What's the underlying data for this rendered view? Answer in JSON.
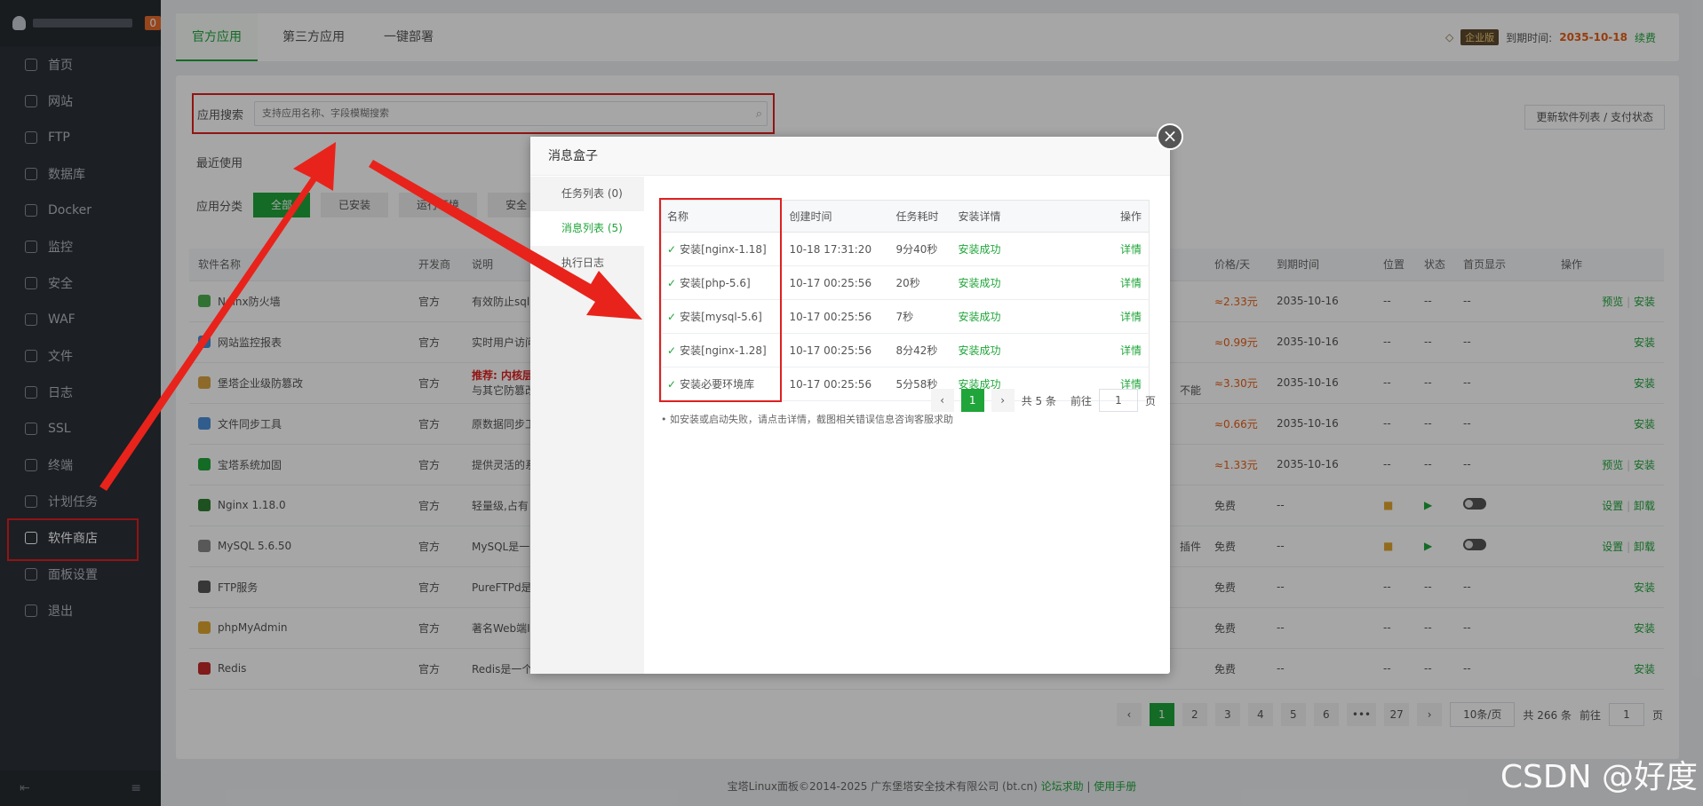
{
  "sidebar": {
    "brand_badge": "0",
    "items": [
      {
        "label": "首页",
        "icon": "home-icon"
      },
      {
        "label": "网站",
        "icon": "globe-icon"
      },
      {
        "label": "FTP",
        "icon": "ftp-icon"
      },
      {
        "label": "数据库",
        "icon": "database-icon"
      },
      {
        "label": "Docker",
        "icon": "docker-icon"
      },
      {
        "label": "监控",
        "icon": "monitor-icon"
      },
      {
        "label": "安全",
        "icon": "shield-icon"
      },
      {
        "label": "WAF",
        "icon": "waf-icon"
      },
      {
        "label": "文件",
        "icon": "folder-icon"
      },
      {
        "label": "日志",
        "icon": "log-icon"
      },
      {
        "label": "SSL",
        "icon": "ssl-icon"
      },
      {
        "label": "终端",
        "icon": "terminal-icon"
      },
      {
        "label": "计划任务",
        "icon": "clock-icon"
      },
      {
        "label": "软件商店",
        "icon": "grid-icon"
      },
      {
        "label": "面板设置",
        "icon": "gear-icon"
      },
      {
        "label": "退出",
        "icon": "logout-icon"
      }
    ]
  },
  "topbar": {
    "tabs": [
      "官方应用",
      "第三方应用",
      "一键部署"
    ],
    "edition": "企业版",
    "expire_label": "到期时间:",
    "expire_date": "2035-10-18",
    "renew": "续费"
  },
  "search": {
    "label": "应用搜索",
    "placeholder": "支持应用名称、字段模糊搜索"
  },
  "update_button": "更新软件列表 / 支付状态",
  "recent_label": "最近使用",
  "category": {
    "label": "应用分类",
    "items": [
      "全部",
      "已安装",
      "运行环境",
      "安全"
    ]
  },
  "apps_table": {
    "headers": [
      "软件名称",
      "开发商",
      "说明",
      "价格/天",
      "到期时间",
      "位置",
      "状态",
      "首页显示",
      "操作"
    ],
    "rows": [
      {
        "name": "Nginx防火墙",
        "dev": "官方",
        "desc": "有效防止sql",
        "price": "≈2.33元",
        "expire": "2035-10-16",
        "pos": "--",
        "status": "--",
        "home": "--",
        "ops": [
          "预览",
          "安装"
        ],
        "color": "#4caf50"
      },
      {
        "name": "网站监控报表",
        "dev": "官方",
        "desc": "实时用户访问",
        "price": "≈0.99元",
        "expire": "2035-10-16",
        "pos": "--",
        "status": "--",
        "home": "--",
        "ops": [
          "安装"
        ],
        "color": "#3f8fd8"
      },
      {
        "name": "堡塔企业级防篡改",
        "dev": "官方",
        "desc": "推荐: 内核层",
        "desc2": "与其它防篡改",
        "price": "≈3.30元",
        "expire": "2035-10-16",
        "pos": "--",
        "status": "--",
        "home": "--",
        "ops": [
          "安装"
        ],
        "color": "#d9a441",
        "note": "不能"
      },
      {
        "name": "文件同步工具",
        "dev": "官方",
        "desc": "原数据同步工",
        "price": "≈0.66元",
        "expire": "2035-10-16",
        "pos": "--",
        "status": "--",
        "home": "--",
        "ops": [
          "安装"
        ],
        "color": "#4a90d9"
      },
      {
        "name": "宝塔系统加固",
        "dev": "官方",
        "desc": "提供灵活的系",
        "price": "≈1.33元",
        "expire": "2035-10-16",
        "pos": "--",
        "status": "--",
        "home": "--",
        "ops": [
          "预览",
          "安装"
        ],
        "color": "#20a53a"
      },
      {
        "name": "Nginx 1.18.0",
        "dev": "官方",
        "desc": "轻量级,占有",
        "price": "免费",
        "expire": "--",
        "pos": "folder",
        "status": "play",
        "home": "toggle",
        "ops": [
          "设置",
          "卸载"
        ],
        "color": "#2e7d32"
      },
      {
        "name": "MySQL 5.6.50",
        "dev": "官方",
        "desc": "MySQL是一",
        "price": "免费",
        "expire": "--",
        "pos": "folder",
        "status": "play",
        "home": "toggle",
        "ops": [
          "设置",
          "卸载"
        ],
        "color": "#888888",
        "note": "插件"
      },
      {
        "name": "FTP服务",
        "dev": "官方",
        "desc": "PureFTPd是",
        "price": "免费",
        "expire": "--",
        "pos": "--",
        "status": "--",
        "home": "--",
        "ops": [
          "安装"
        ],
        "color": "#555555"
      },
      {
        "name": "phpMyAdmin",
        "dev": "官方",
        "desc": "著名Web端I",
        "price": "免费",
        "expire": "--",
        "pos": "--",
        "status": "--",
        "home": "--",
        "ops": [
          "安装"
        ],
        "color": "#e0a72e"
      },
      {
        "name": "Redis",
        "dev": "官方",
        "desc": "Redis是一个",
        "price": "免费",
        "expire": "--",
        "pos": "--",
        "status": "--",
        "home": "--",
        "ops": [
          "安装"
        ],
        "color": "#c62828"
      }
    ]
  },
  "pager": {
    "pages": [
      "1",
      "2",
      "3",
      "4",
      "5",
      "6",
      "•••",
      "27"
    ],
    "per_page": "10条/页",
    "total": "共 266 条",
    "goto": "前往",
    "goto_value": "1",
    "page_unit": "页"
  },
  "footer": {
    "text": "宝塔Linux面板©2014-2025 广东堡塔安全技术有限公司 (bt.cn)",
    "forum": "论坛求助",
    "sep": "|",
    "manual": "使用手册"
  },
  "watermark": "CSDN @好度",
  "modal": {
    "title": "消息盒子",
    "close": "×",
    "tabs": [
      "任务列表 (0)",
      "消息列表 (5)",
      "执行日志"
    ],
    "headers": [
      "名称",
      "创建时间",
      "任务耗时",
      "安装详情",
      "操作"
    ],
    "rows": [
      {
        "name": "安装[nginx-1.18]",
        "time": "10-18 17:31:20",
        "cost": "9分40秒",
        "result": "安装成功",
        "op": "详情"
      },
      {
        "name": "安装[php-5.6]",
        "time": "10-17 00:25:56",
        "cost": "20秒",
        "result": "安装成功",
        "op": "详情"
      },
      {
        "name": "安装[mysql-5.6]",
        "time": "10-17 00:25:56",
        "cost": "7秒",
        "result": "安装成功",
        "op": "详情"
      },
      {
        "name": "安装[nginx-1.28]",
        "time": "10-17 00:25:56",
        "cost": "8分42秒",
        "result": "安装成功",
        "op": "详情"
      },
      {
        "name": "安装必要环境库",
        "time": "10-17 00:25:56",
        "cost": "5分58秒",
        "result": "安装成功",
        "op": "详情"
      }
    ],
    "note": "• 如安装或启动失败，请点击详情，截图相关错误信息咨询客服求助",
    "pager": {
      "page": "1",
      "total": "共 5 条",
      "goto": "前往",
      "goto_value": "1",
      "unit": "页"
    }
  }
}
